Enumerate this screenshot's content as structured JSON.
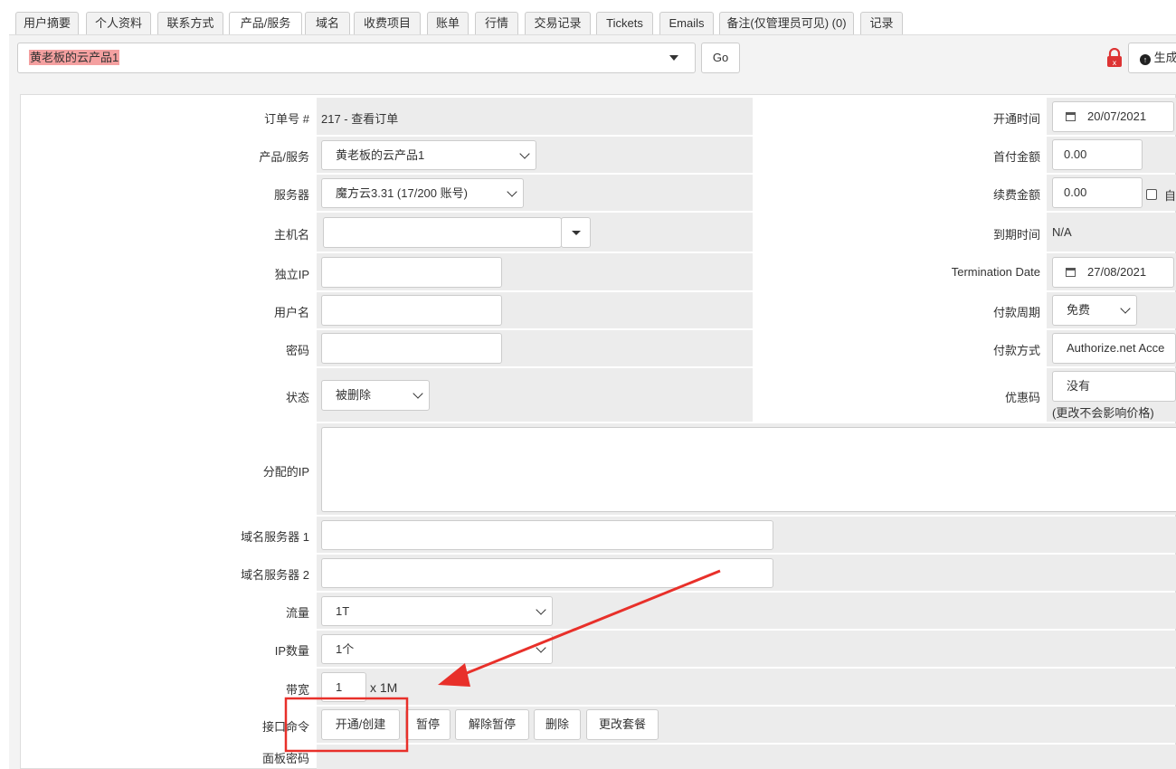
{
  "tabs": [
    "用户摘要",
    "个人资料",
    "联系方式",
    "产品/服务",
    "域名",
    "收费项目",
    "账单",
    "行情",
    "交易记录",
    "Tickets",
    "Emails",
    "备注(仅管理员可见) (0)",
    "记录"
  ],
  "topbar": {
    "product_select": "黄老板的云产品1",
    "go_label": "Go",
    "generate_label": "生成"
  },
  "left": {
    "order_label": "订单号 #",
    "order_value": "217 - 查看订单",
    "product_label": "产品/服务",
    "product_value": "黄老板的云产品1",
    "server_label": "服务器",
    "server_value": "魔方云3.31 (17/200 账号)",
    "hostname_label": "主机名",
    "hostname_value": "",
    "ip_label": "独立IP",
    "ip_value": "",
    "username_label": "用户名",
    "username_value": "",
    "password_label": "密码",
    "password_value": "",
    "status_label": "状态",
    "status_value": "被删除"
  },
  "right": {
    "open_label": "开通时间",
    "open_value": "20/07/2021",
    "first_label": "首付金额",
    "first_value": "0.00",
    "renew_label": "续费金额",
    "renew_value": "0.00",
    "renew_check_label": "自",
    "expire_label": "到期时间",
    "expire_value": "N/A",
    "term_label": "Termination Date",
    "term_value": "27/08/2021",
    "cycle_label": "付款周期",
    "cycle_value": "免费",
    "pay_label": "付款方式",
    "pay_value": "Authorize.net Acce",
    "coupon_label": "优惠码",
    "coupon_value": "没有",
    "coupon_note": "(更改不会影响价格)"
  },
  "lower": {
    "assigned_ip_label": "分配的IP",
    "ns1_label": "域名服务器 1",
    "ns2_label": "域名服务器 2",
    "traffic_label": "流量",
    "traffic_value": "1T",
    "ipcount_label": "IP数量",
    "ipcount_value": "1个",
    "bw_label": "带宽",
    "bw_value": "1",
    "bw_unit": "x 1M",
    "cmd_label": "接口命令",
    "cmd_buttons": [
      "开通/创建",
      "暂停",
      "解除暂停",
      "删除",
      "更改套餐"
    ],
    "panel_pw_label": "面板密码"
  },
  "colors": {
    "annotation": "#e8302a",
    "highlight": "#f4a0a0",
    "row_bg": "#ececec"
  }
}
